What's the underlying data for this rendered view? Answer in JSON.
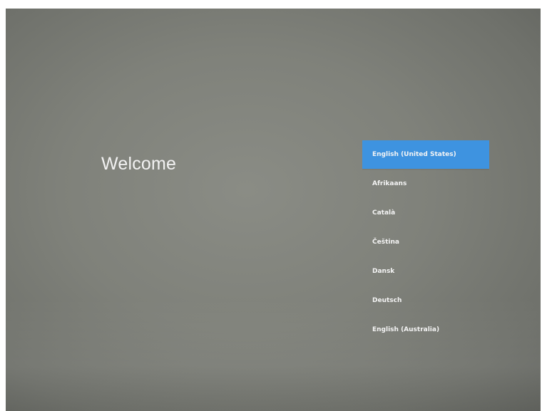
{
  "welcome": {
    "title": "Welcome"
  },
  "language_list": {
    "items": [
      {
        "label": "English (United States)",
        "selected": true
      },
      {
        "label": "Afrikaans",
        "selected": false
      },
      {
        "label": "Català",
        "selected": false
      },
      {
        "label": "Čeština",
        "selected": false
      },
      {
        "label": "Dansk",
        "selected": false
      },
      {
        "label": "Deutsch",
        "selected": false
      },
      {
        "label": "English (Australia)",
        "selected": false
      }
    ]
  },
  "colors": {
    "accent": "#3e93e0",
    "background": "#7f817a",
    "text": "#f2f2f2"
  }
}
